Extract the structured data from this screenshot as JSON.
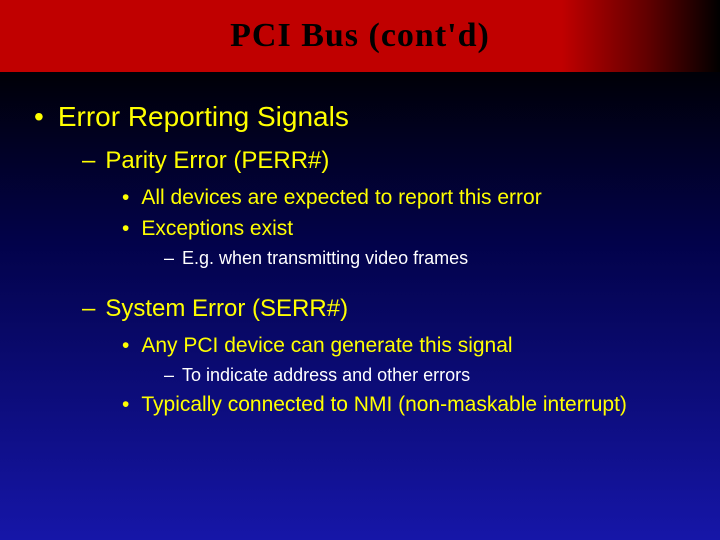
{
  "title": "PCI Bus (cont'd)",
  "bullets": {
    "l1_error_reporting": "Error Reporting Signals",
    "l2_parity": "Parity Error (PERR#)",
    "l3_all_devices": "All devices are expected to report this error",
    "l3_exceptions": "Exceptions exist",
    "l4_eg_video": "E.g. when transmitting video frames",
    "l2_system_error": "System Error (SERR#)",
    "l3_any_pci": "Any PCI device can generate this signal",
    "l4_to_indicate": "To indicate address and other errors",
    "l3_nmi": "Typically connected to NMI (non-maskable interrupt)"
  },
  "markers": {
    "bullet": "•",
    "dash": "–"
  }
}
